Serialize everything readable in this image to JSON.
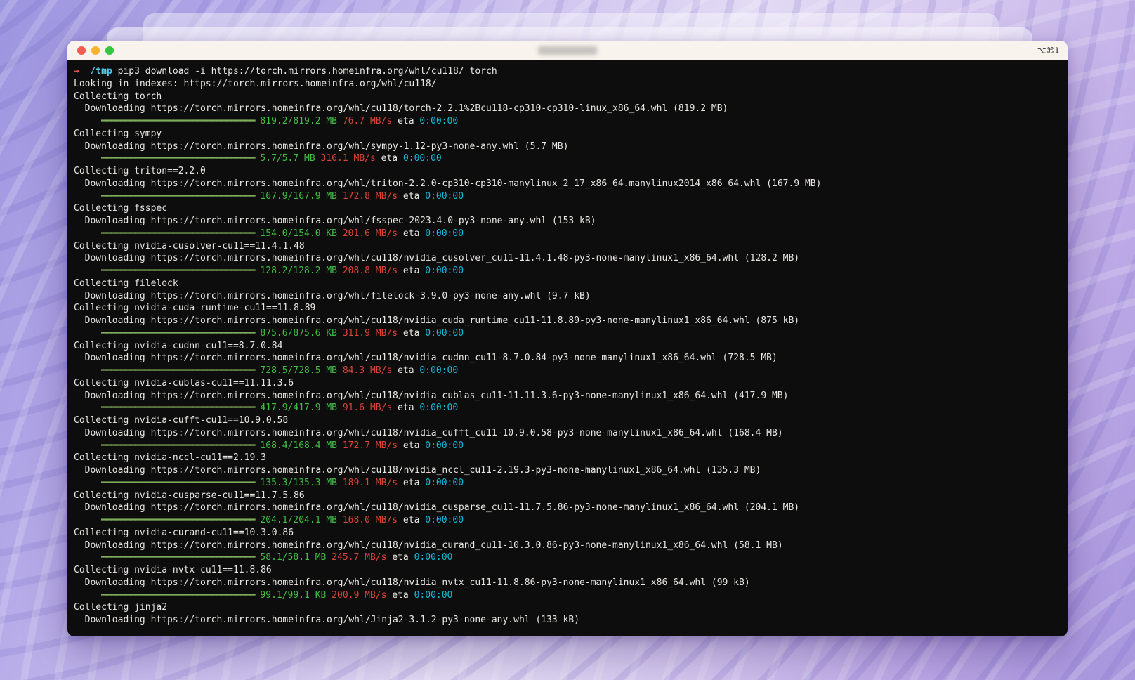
{
  "window": {
    "shortcut_label": "⌥⌘1",
    "traffic_colors": {
      "close": "#f25c4f",
      "minimize": "#f5b32f",
      "zoom": "#35c53f"
    }
  },
  "terminal": {
    "colors": {
      "background": "#0d0d0d",
      "foreground": "#e9e7e3",
      "green": "#3fbf44",
      "bar_green": "#7fae5a",
      "red": "#d9453b",
      "cyan": "#15b9d5",
      "prompt_arrow": "#e8564a",
      "prompt_path": "#56c8e9"
    },
    "progress_bar": {
      "char": "━",
      "length": 32,
      "indent": "     "
    },
    "eta_label": "eta",
    "lines": [
      {
        "type": "command",
        "arrow": "→",
        "path": "/tmp",
        "text": "pip3 download -i https://torch.mirrors.homeinfra.org/whl/cu118/ torch"
      },
      {
        "type": "plain",
        "text": "Looking in indexes: https://torch.mirrors.homeinfra.org/whl/cu118/"
      },
      {
        "type": "plain",
        "text": "Collecting torch"
      },
      {
        "type": "plain",
        "text": "  Downloading https://torch.mirrors.homeinfra.org/whl/cu118/torch-2.2.1%2Bcu118-cp310-cp310-linux_x86_64.whl (819.2 MB)"
      },
      {
        "type": "progress",
        "done": "819.2/819.2 MB",
        "speed": "76.7 MB/s",
        "eta": "0:00:00"
      },
      {
        "type": "plain",
        "text": "Collecting sympy"
      },
      {
        "type": "plain",
        "text": "  Downloading https://torch.mirrors.homeinfra.org/whl/sympy-1.12-py3-none-any.whl (5.7 MB)"
      },
      {
        "type": "progress",
        "done": "5.7/5.7 MB",
        "speed": "316.1 MB/s",
        "eta": "0:00:00"
      },
      {
        "type": "plain",
        "text": "Collecting triton==2.2.0"
      },
      {
        "type": "plain",
        "text": "  Downloading https://torch.mirrors.homeinfra.org/whl/triton-2.2.0-cp310-cp310-manylinux_2_17_x86_64.manylinux2014_x86_64.whl (167.9 MB)"
      },
      {
        "type": "progress",
        "done": "167.9/167.9 MB",
        "speed": "172.8 MB/s",
        "eta": "0:00:00"
      },
      {
        "type": "plain",
        "text": "Collecting fsspec"
      },
      {
        "type": "plain",
        "text": "  Downloading https://torch.mirrors.homeinfra.org/whl/fsspec-2023.4.0-py3-none-any.whl (153 kB)"
      },
      {
        "type": "progress",
        "done": "154.0/154.0 KB",
        "speed": "201.6 MB/s",
        "eta": "0:00:00"
      },
      {
        "type": "plain",
        "text": "Collecting nvidia-cusolver-cu11==11.4.1.48"
      },
      {
        "type": "plain",
        "text": "  Downloading https://torch.mirrors.homeinfra.org/whl/cu118/nvidia_cusolver_cu11-11.4.1.48-py3-none-manylinux1_x86_64.whl (128.2 MB)"
      },
      {
        "type": "progress",
        "done": "128.2/128.2 MB",
        "speed": "208.8 MB/s",
        "eta": "0:00:00"
      },
      {
        "type": "plain",
        "text": "Collecting filelock"
      },
      {
        "type": "plain",
        "text": "  Downloading https://torch.mirrors.homeinfra.org/whl/filelock-3.9.0-py3-none-any.whl (9.7 kB)"
      },
      {
        "type": "plain",
        "text": "Collecting nvidia-cuda-runtime-cu11==11.8.89"
      },
      {
        "type": "plain",
        "text": "  Downloading https://torch.mirrors.homeinfra.org/whl/cu118/nvidia_cuda_runtime_cu11-11.8.89-py3-none-manylinux1_x86_64.whl (875 kB)"
      },
      {
        "type": "progress",
        "done": "875.6/875.6 KB",
        "speed": "311.9 MB/s",
        "eta": "0:00:00"
      },
      {
        "type": "plain",
        "text": "Collecting nvidia-cudnn-cu11==8.7.0.84"
      },
      {
        "type": "plain",
        "text": "  Downloading https://torch.mirrors.homeinfra.org/whl/cu118/nvidia_cudnn_cu11-8.7.0.84-py3-none-manylinux1_x86_64.whl (728.5 MB)"
      },
      {
        "type": "progress",
        "done": "728.5/728.5 MB",
        "speed": "84.3 MB/s",
        "eta": "0:00:00"
      },
      {
        "type": "plain",
        "text": "Collecting nvidia-cublas-cu11==11.11.3.6"
      },
      {
        "type": "plain",
        "text": "  Downloading https://torch.mirrors.homeinfra.org/whl/cu118/nvidia_cublas_cu11-11.11.3.6-py3-none-manylinux1_x86_64.whl (417.9 MB)"
      },
      {
        "type": "progress",
        "done": "417.9/417.9 MB",
        "speed": "91.6 MB/s",
        "eta": "0:00:00"
      },
      {
        "type": "plain",
        "text": "Collecting nvidia-cufft-cu11==10.9.0.58"
      },
      {
        "type": "plain",
        "text": "  Downloading https://torch.mirrors.homeinfra.org/whl/cu118/nvidia_cufft_cu11-10.9.0.58-py3-none-manylinux1_x86_64.whl (168.4 MB)"
      },
      {
        "type": "progress",
        "done": "168.4/168.4 MB",
        "speed": "172.7 MB/s",
        "eta": "0:00:00"
      },
      {
        "type": "plain",
        "text": "Collecting nvidia-nccl-cu11==2.19.3"
      },
      {
        "type": "plain",
        "text": "  Downloading https://torch.mirrors.homeinfra.org/whl/cu118/nvidia_nccl_cu11-2.19.3-py3-none-manylinux1_x86_64.whl (135.3 MB)"
      },
      {
        "type": "progress",
        "done": "135.3/135.3 MB",
        "speed": "189.1 MB/s",
        "eta": "0:00:00"
      },
      {
        "type": "plain",
        "text": "Collecting nvidia-cusparse-cu11==11.7.5.86"
      },
      {
        "type": "plain",
        "text": "  Downloading https://torch.mirrors.homeinfra.org/whl/cu118/nvidia_cusparse_cu11-11.7.5.86-py3-none-manylinux1_x86_64.whl (204.1 MB)"
      },
      {
        "type": "progress",
        "done": "204.1/204.1 MB",
        "speed": "168.0 MB/s",
        "eta": "0:00:00"
      },
      {
        "type": "plain",
        "text": "Collecting nvidia-curand-cu11==10.3.0.86"
      },
      {
        "type": "plain",
        "text": "  Downloading https://torch.mirrors.homeinfra.org/whl/cu118/nvidia_curand_cu11-10.3.0.86-py3-none-manylinux1_x86_64.whl (58.1 MB)"
      },
      {
        "type": "progress",
        "done": "58.1/58.1 MB",
        "speed": "245.7 MB/s",
        "eta": "0:00:00"
      },
      {
        "type": "plain",
        "text": "Collecting nvidia-nvtx-cu11==11.8.86"
      },
      {
        "type": "plain",
        "text": "  Downloading https://torch.mirrors.homeinfra.org/whl/cu118/nvidia_nvtx_cu11-11.8.86-py3-none-manylinux1_x86_64.whl (99 kB)"
      },
      {
        "type": "progress",
        "done": "99.1/99.1 KB",
        "speed": "200.9 MB/s",
        "eta": "0:00:00"
      },
      {
        "type": "plain",
        "text": "Collecting jinja2"
      },
      {
        "type": "plain",
        "text": "  Downloading https://torch.mirrors.homeinfra.org/whl/Jinja2-3.1.2-py3-none-any.whl (133 kB)"
      }
    ]
  }
}
